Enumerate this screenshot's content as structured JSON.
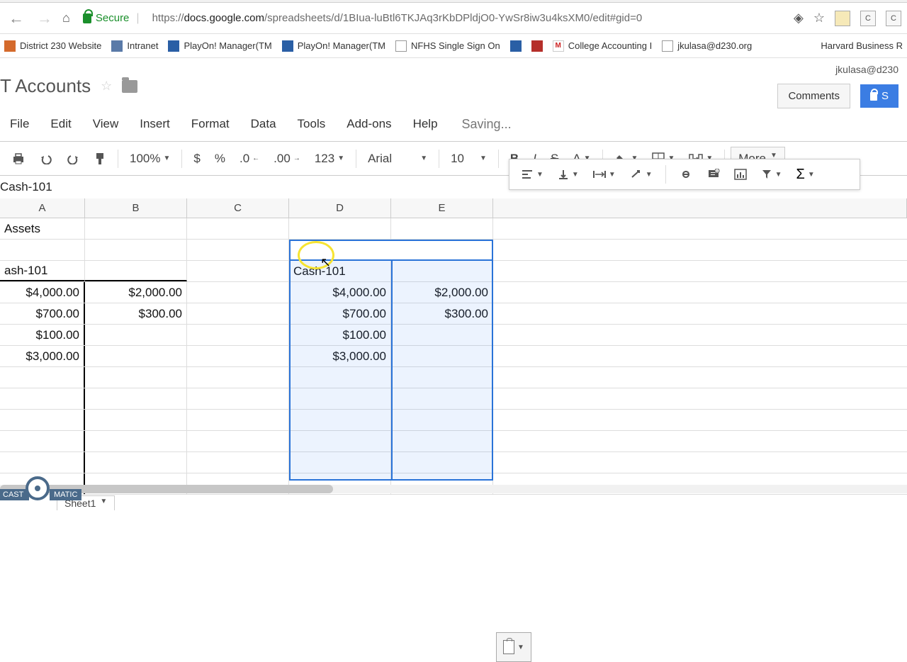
{
  "browser": {
    "secure_label": "Secure",
    "url_prefix": "https://",
    "url_host": "docs.google.com",
    "url_path": "/spreadsheets/d/1BIua-luBtl6TKJAq3rKbDPldjO0-YwSr8iw3u4ksXM0/edit#gid=0"
  },
  "bookmarks": [
    {
      "label": "District 230 Website"
    },
    {
      "label": "Intranet"
    },
    {
      "label": "PlayOn! Manager(TM"
    },
    {
      "label": "PlayOn! Manager(TM"
    },
    {
      "label": "NFHS Single Sign On"
    },
    {
      "label": ""
    },
    {
      "label": ""
    },
    {
      "label": "College Accounting I"
    },
    {
      "label": "jkulasa@d230.org"
    },
    {
      "label": "Harvard Business R"
    }
  ],
  "doc": {
    "title": "T Accounts",
    "user_email": "jkulasa@d230",
    "comments_label": "Comments",
    "share_label": "S",
    "saving": "Saving..."
  },
  "menu": [
    "File",
    "Edit",
    "View",
    "Insert",
    "Format",
    "Data",
    "Tools",
    "Add-ons",
    "Help"
  ],
  "toolbar": {
    "zoom": "100%",
    "font": "Arial",
    "size": "10",
    "more": "More",
    "num_fmt": "123"
  },
  "cellref": "Cash-101",
  "columns": [
    "A",
    "B",
    "C",
    "D",
    "E"
  ],
  "sheet_tab": "Sheet1",
  "cells": {
    "r1": {
      "A": "Assets"
    },
    "r3": {
      "A": "ash-101",
      "D": "Cash-101"
    },
    "r4": {
      "A": "$4,000.00",
      "B": "$2,000.00",
      "D": "$4,000.00",
      "E": "$2,000.00"
    },
    "r5": {
      "A": "$700.00",
      "B": "$300.00",
      "D": "$700.00",
      "E": "$300.00"
    },
    "r6": {
      "A": "$100.00",
      "D": "$100.00"
    },
    "r7": {
      "A": "$3,000.00",
      "D": "$3,000.00"
    }
  },
  "watermark": {
    "a": "CAST",
    "b": "MATIC"
  }
}
